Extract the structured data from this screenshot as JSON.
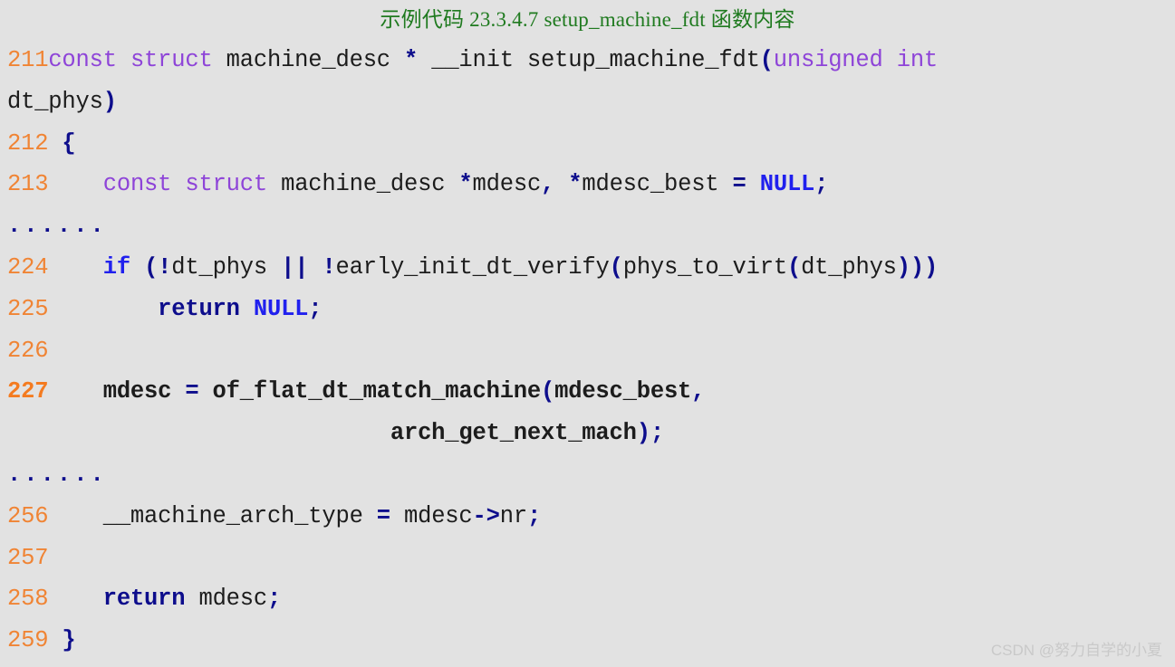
{
  "title": "示例代码 23.3.4.7 setup_machine_fdt 函数内容",
  "title_color": "#1f7a1f",
  "background_color": "#e2e2e2",
  "colors": {
    "line_number": "#f08434",
    "keyword": "#8e44d8",
    "operator": "#0d0d8c",
    "literal": "#2020ee",
    "identifier": "#1c1c1c",
    "watermark": "#c9c9c9"
  },
  "code": {
    "language": "c",
    "lines": [
      {
        "number": "211",
        "bold": false,
        "tokens": [
          {
            "t": "const",
            "c": "kw"
          },
          {
            "t": " ",
            "c": "plain"
          },
          {
            "t": "struct",
            "c": "kw"
          },
          {
            "t": " machine_desc ",
            "c": "plain"
          },
          {
            "t": "*",
            "c": "op"
          },
          {
            "t": " __init setup_machine_fdt",
            "c": "plain"
          },
          {
            "t": "(",
            "c": "op"
          },
          {
            "t": "unsigned",
            "c": "kw"
          },
          {
            "t": " ",
            "c": "plain"
          },
          {
            "t": "int",
            "c": "kw"
          }
        ]
      },
      {
        "number": "",
        "bold": false,
        "tokens": [
          {
            "t": "dt_phys",
            "c": "plain"
          },
          {
            "t": ")",
            "c": "op"
          }
        ]
      },
      {
        "number": "212",
        "bold": false,
        "tokens": [
          {
            "t": " ",
            "c": "plain"
          },
          {
            "t": "{",
            "c": "op"
          }
        ]
      },
      {
        "number": "213",
        "bold": false,
        "tokens": [
          {
            "t": "    ",
            "c": "plain"
          },
          {
            "t": "const",
            "c": "kw"
          },
          {
            "t": " ",
            "c": "plain"
          },
          {
            "t": "struct",
            "c": "kw"
          },
          {
            "t": " machine_desc ",
            "c": "plain"
          },
          {
            "t": "*",
            "c": "op"
          },
          {
            "t": "mdesc",
            "c": "plain"
          },
          {
            "t": ",",
            "c": "op"
          },
          {
            "t": " ",
            "c": "plain"
          },
          {
            "t": "*",
            "c": "op"
          },
          {
            "t": "mdesc_best ",
            "c": "plain"
          },
          {
            "t": "=",
            "c": "op"
          },
          {
            "t": " ",
            "c": "plain"
          },
          {
            "t": "NULL",
            "c": "blu"
          },
          {
            "t": ";",
            "c": "op"
          }
        ]
      },
      {
        "number": "",
        "bold": false,
        "ellipsis": "......",
        "tokens": []
      },
      {
        "number": "224",
        "bold": false,
        "tokens": [
          {
            "t": "    ",
            "c": "plain"
          },
          {
            "t": "if",
            "c": "blu"
          },
          {
            "t": " ",
            "c": "plain"
          },
          {
            "t": "(",
            "c": "op"
          },
          {
            "t": "!",
            "c": "op"
          },
          {
            "t": "dt_phys ",
            "c": "plain"
          },
          {
            "t": "||",
            "c": "op"
          },
          {
            "t": " ",
            "c": "plain"
          },
          {
            "t": "!",
            "c": "op"
          },
          {
            "t": "early_init_dt_verify",
            "c": "plain"
          },
          {
            "t": "(",
            "c": "op"
          },
          {
            "t": "phys_to_virt",
            "c": "plain"
          },
          {
            "t": "(",
            "c": "op"
          },
          {
            "t": "dt_phys",
            "c": "plain"
          },
          {
            "t": ")))",
            "c": "op"
          }
        ]
      },
      {
        "number": "225",
        "bold": false,
        "tokens": [
          {
            "t": "        ",
            "c": "plain"
          },
          {
            "t": "return",
            "c": "op"
          },
          {
            "t": " ",
            "c": "plain"
          },
          {
            "t": "NULL",
            "c": "blu"
          },
          {
            "t": ";",
            "c": "op"
          }
        ]
      },
      {
        "number": "226",
        "bold": false,
        "tokens": []
      },
      {
        "number": "227",
        "bold": true,
        "tokens": [
          {
            "t": "    mdesc ",
            "c": "plain"
          },
          {
            "t": "=",
            "c": "op"
          },
          {
            "t": " of_flat_dt_match_machine",
            "c": "plain"
          },
          {
            "t": "(",
            "c": "op"
          },
          {
            "t": "mdesc_best",
            "c": "plain"
          },
          {
            "t": ",",
            "c": "op"
          }
        ]
      },
      {
        "number": "",
        "bold": true,
        "tokens": [
          {
            "t": "                            arch_get_next_mach",
            "c": "plain"
          },
          {
            "t": ");",
            "c": "op"
          }
        ]
      },
      {
        "number": "",
        "bold": false,
        "ellipsis": "......",
        "tokens": []
      },
      {
        "number": "256",
        "bold": false,
        "tokens": [
          {
            "t": "    __machine_arch_type ",
            "c": "plain"
          },
          {
            "t": "=",
            "c": "op"
          },
          {
            "t": " mdesc",
            "c": "plain"
          },
          {
            "t": "->",
            "c": "op"
          },
          {
            "t": "nr",
            "c": "plain"
          },
          {
            "t": ";",
            "c": "op"
          }
        ]
      },
      {
        "number": "257",
        "bold": false,
        "tokens": []
      },
      {
        "number": "258",
        "bold": false,
        "tokens": [
          {
            "t": "    ",
            "c": "plain"
          },
          {
            "t": "return",
            "c": "op"
          },
          {
            "t": " mdesc",
            "c": "plain"
          },
          {
            "t": ";",
            "c": "op"
          }
        ]
      },
      {
        "number": "259",
        "bold": false,
        "tokens": [
          {
            "t": " ",
            "c": "plain"
          },
          {
            "t": "}",
            "c": "op"
          }
        ]
      }
    ]
  },
  "watermark": "CSDN @努力自学的小夏"
}
